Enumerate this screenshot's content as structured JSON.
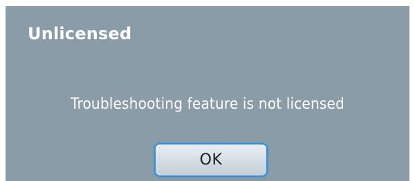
{
  "dialog": {
    "title": "Unlicensed",
    "message": "Troubleshooting feature is not licensed",
    "ok_label": "OK"
  },
  "colors": {
    "dialog_background": "#8a9ca7",
    "button_border": "#2c8fe0",
    "text": "#ffffff"
  }
}
